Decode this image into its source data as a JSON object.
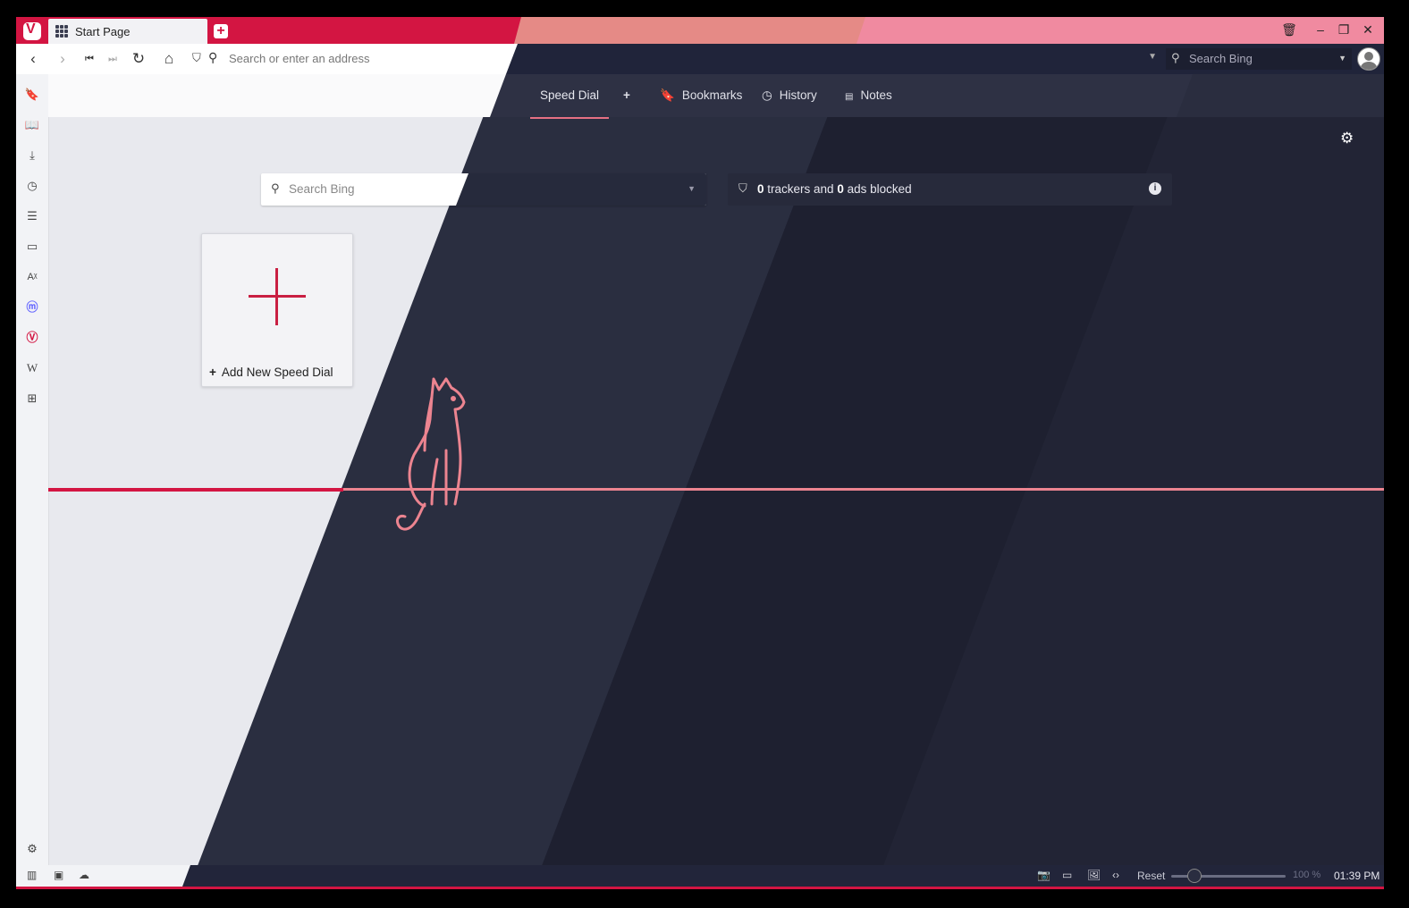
{
  "tab": {
    "title": "Start Page"
  },
  "addressbar": {
    "placeholder": "Search or enter an address",
    "search_placeholder": "Search Bing"
  },
  "startpage": {
    "tabs": [
      {
        "label": "Speed Dial"
      },
      {
        "label": "+"
      },
      {
        "label": "Bookmarks"
      },
      {
        "label": "History"
      },
      {
        "label": "Notes"
      }
    ],
    "search_placeholder": "Search Bing",
    "tracker": {
      "count_trackers": "0",
      "mid": " trackers and ",
      "count_ads": "0",
      "end": " ads blocked"
    },
    "speed_dial_add_label": "Add New Speed Dial"
  },
  "statusbar": {
    "reset_label": "Reset",
    "zoom": "100 %",
    "clock": "01:39 PM"
  },
  "colors": {
    "accent": "#d31542",
    "line": "#ec8490",
    "dark_bg": "#1e2030"
  },
  "icons": {
    "sidebar": [
      "bookmark-icon",
      "reading-list-icon",
      "download-icon",
      "history-icon",
      "notes-icon",
      "window-icon",
      "translate-icon",
      "mastodon-icon",
      "vivaldi-icon",
      "wikipedia-icon",
      "add-panel-icon",
      "settings-icon"
    ]
  }
}
